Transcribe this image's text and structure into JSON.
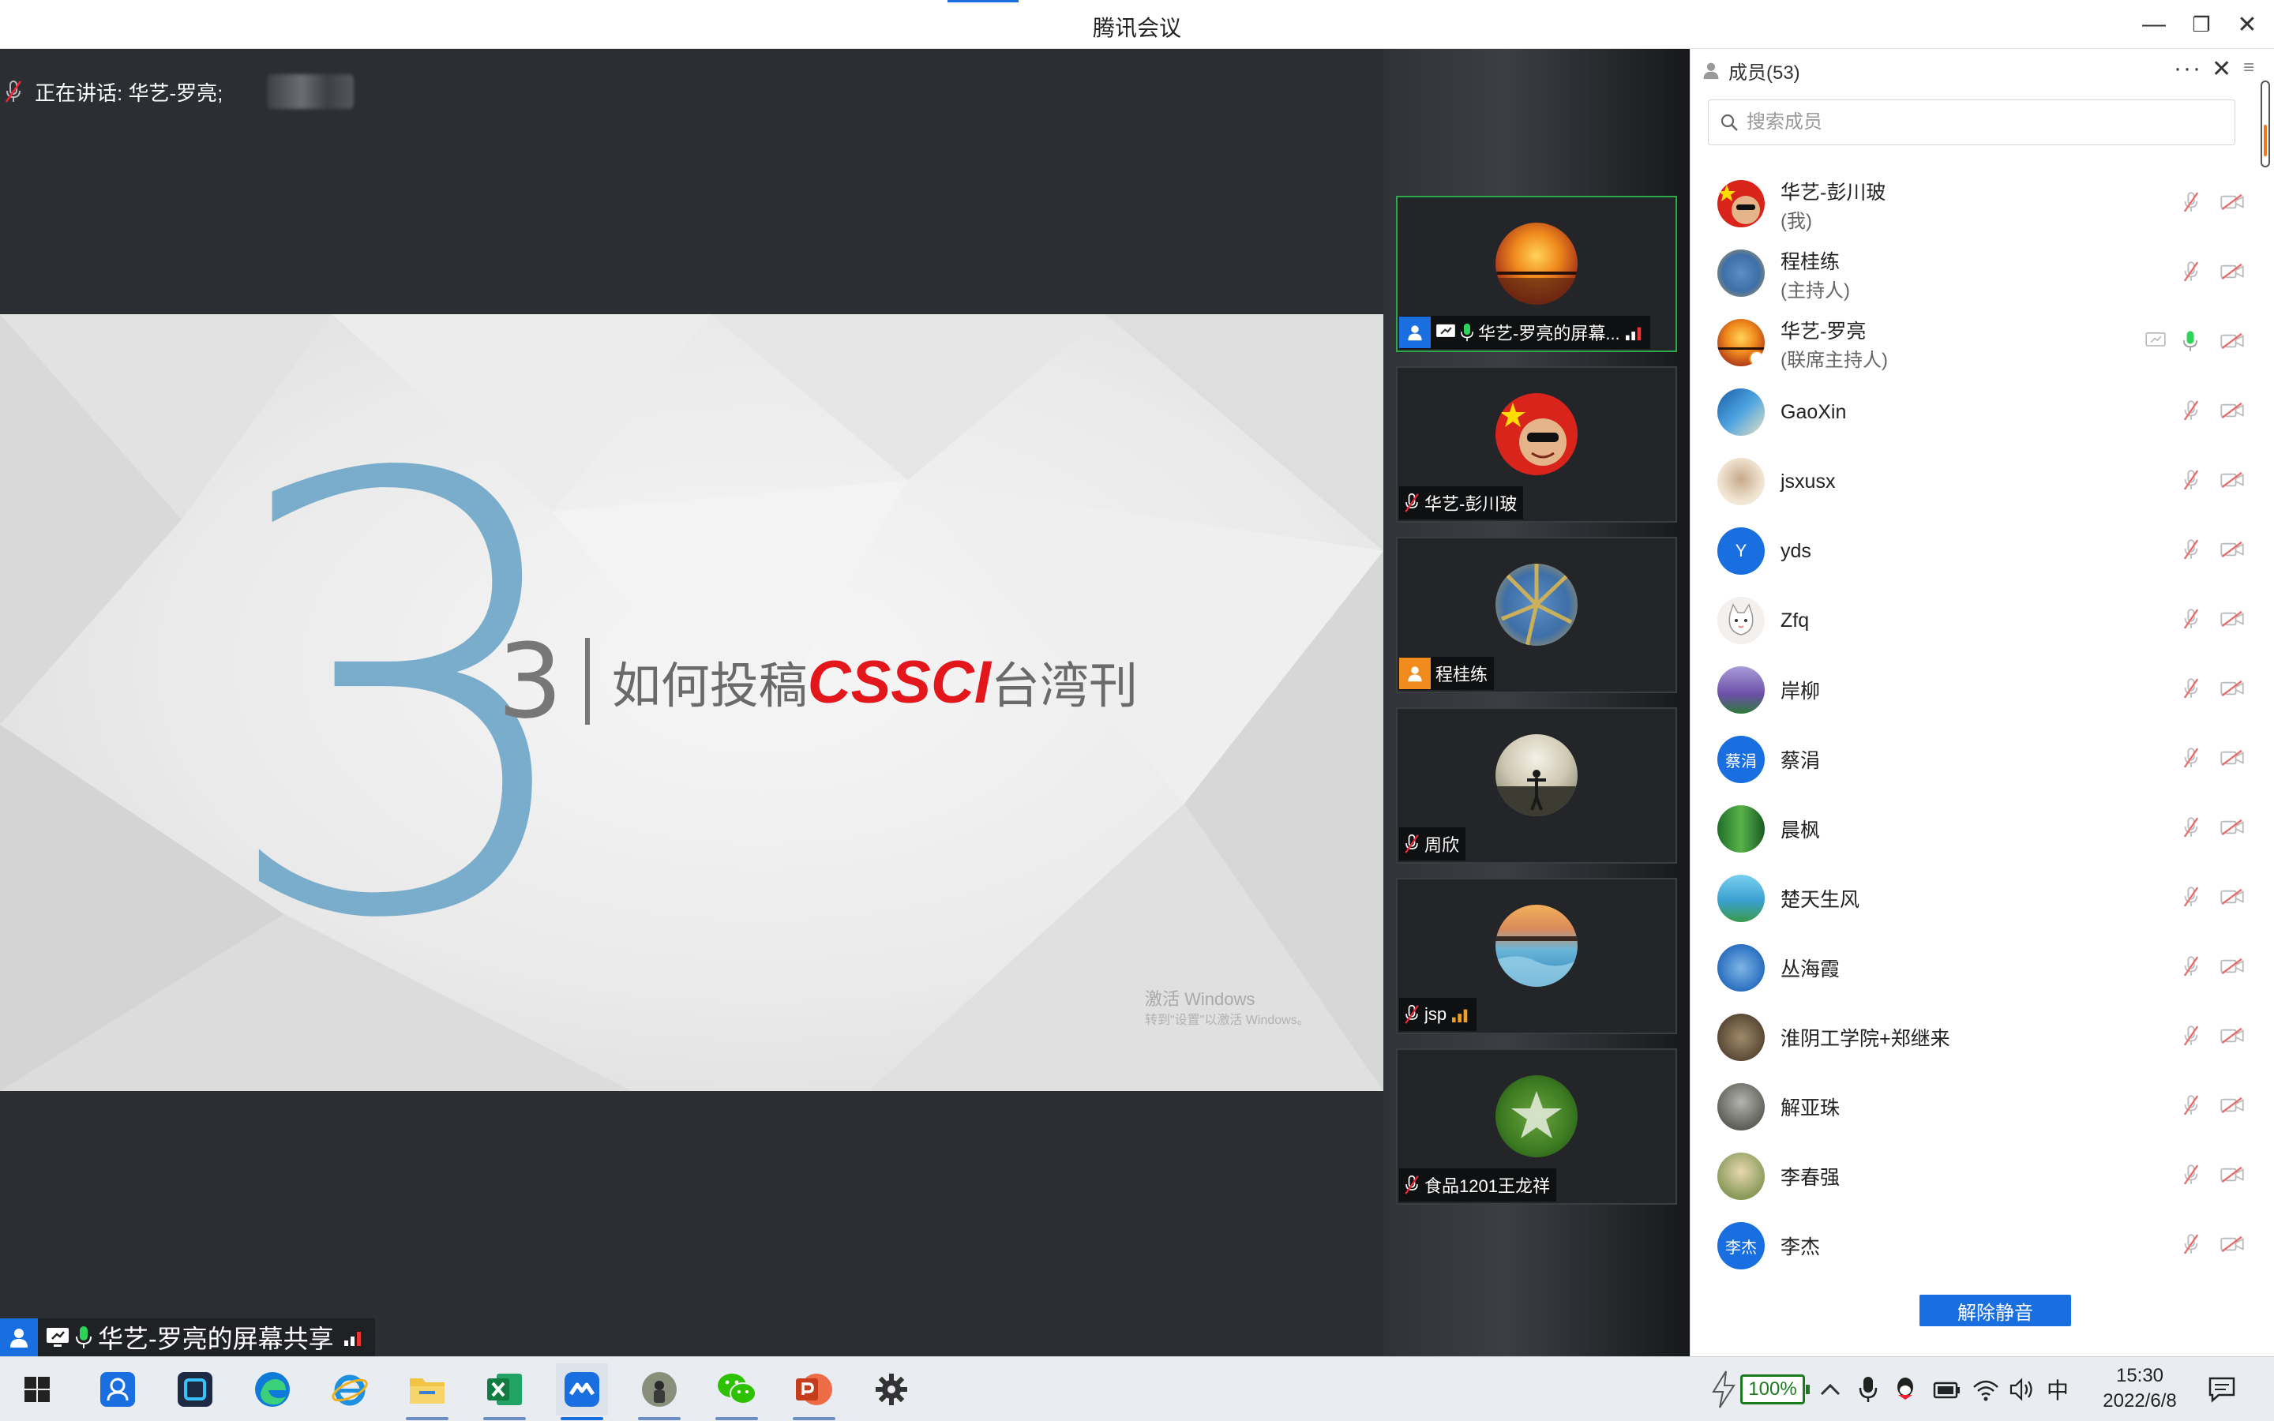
{
  "window": {
    "title": "腾讯会议",
    "minimize": "—",
    "restore": "❐",
    "close": "✕"
  },
  "stage": {
    "speaking_prefix": "正在讲话: 华艺-罗亮;",
    "slide": {
      "big_number": "3",
      "section_number": "3",
      "heading_part1": "如何投稿",
      "heading_highlight": "CSSCI",
      "heading_part2": "台湾刊",
      "watermark_line1": "激活 Windows",
      "watermark_line2": "转到\"设置\"以激活 Windows。"
    },
    "sharer_label": "华艺-罗亮的屏幕共享"
  },
  "video_tiles": [
    {
      "name": "华艺-罗亮的屏幕...",
      "active": true,
      "badge": "share"
    },
    {
      "name": "华艺-彭川玻",
      "active": false,
      "badge": "muted"
    },
    {
      "name": "程桂练",
      "active": false,
      "badge": "host"
    },
    {
      "name": "周欣",
      "active": false,
      "badge": "muted"
    },
    {
      "name": "jsp",
      "active": false,
      "badge": "muted"
    },
    {
      "name": "食品1201王龙祥",
      "active": false,
      "badge": "muted"
    }
  ],
  "members_panel": {
    "title": "成员(53)",
    "more": "···",
    "close": "✕",
    "menu": "≡",
    "search_placeholder": "搜索成员",
    "members": [
      {
        "name": "华艺-彭川玻",
        "role": "(我)",
        "avatar": "flag"
      },
      {
        "name": "程桂练",
        "role": "(主持人)",
        "avatar": "tree"
      },
      {
        "name": "华艺-罗亮",
        "role": "(联席主持人)",
        "avatar": "sunset"
      },
      {
        "name": "GaoXin",
        "role": "",
        "avatar": "sky"
      },
      {
        "name": "jsxusx",
        "role": "",
        "avatar": "beige"
      },
      {
        "name": "yds",
        "role": "",
        "avatar": "letter",
        "letter": "Y"
      },
      {
        "name": "Zfq",
        "role": "",
        "avatar": "cat"
      },
      {
        "name": "岸柳",
        "role": "",
        "avatar": "purple"
      },
      {
        "name": "蔡涓",
        "role": "",
        "avatar": "letter",
        "letter": "蔡涓"
      },
      {
        "name": "晨枫",
        "role": "",
        "avatar": "forest"
      },
      {
        "name": "楚天生风",
        "role": "",
        "avatar": "lake"
      },
      {
        "name": "丛海霞",
        "role": "",
        "avatar": "blue"
      },
      {
        "name": "淮阴工学院+郑继来",
        "role": "",
        "avatar": "sepia"
      },
      {
        "name": "解亚珠",
        "role": "",
        "avatar": "grey"
      },
      {
        "name": "李春强",
        "role": "",
        "avatar": "olive"
      },
      {
        "name": "李杰",
        "role": "",
        "avatar": "letter",
        "letter": "李杰"
      }
    ],
    "unmute_button": "解除静音"
  },
  "taskbar": {
    "apps": [
      "windows-start",
      "contacts",
      "app-square",
      "edge",
      "ie",
      "file-explorer",
      "excel",
      "tencent-meeting",
      "photo",
      "wechat",
      "powerpoint",
      "settings"
    ],
    "battery": "100%",
    "ime": "中",
    "time": "15:30",
    "date": "2022/6/8"
  },
  "colors": {
    "accent": "#1a6fe0",
    "slide_number": "#7aadcb",
    "highlight": "#e3161c",
    "active_tile": "#2ea84a"
  }
}
